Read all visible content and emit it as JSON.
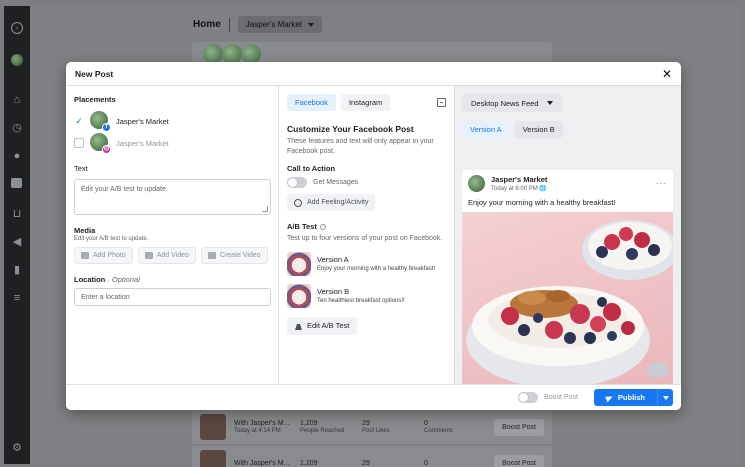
{
  "background": {
    "home_label": "Home",
    "page_selector": "Jasper's Market",
    "rows": [
      {
        "name": "With Jasper's M...",
        "time": "Today at 4:14 PM",
        "reach": "1,209",
        "reach_label": "People Reached",
        "likes": "29",
        "likes_label": "Post Likes",
        "comments": "0",
        "comments_label": "Comments",
        "boost": "Boost Post"
      },
      {
        "name": "With Jasper's M...",
        "reach": "1,209",
        "likes": "29",
        "comments": "0",
        "boost": "Boost Post"
      }
    ]
  },
  "sidebar": {
    "icons": [
      "arrow-right-circle-icon",
      "leaf-avatar-icon",
      "home-icon",
      "history-icon",
      "chat-bubble-icon",
      "pages-icon",
      "shop-icon",
      "megaphone-icon",
      "insights-icon",
      "menu-icon",
      "settings-icon"
    ]
  },
  "modal": {
    "title": "New Post",
    "close_glyph": "✕",
    "placements": {
      "title": "Placements",
      "items": [
        {
          "name": "Jasper's Market",
          "network": "facebook",
          "checked": true
        },
        {
          "name": "Jasper's Market",
          "network": "instagram",
          "checked": false
        }
      ]
    },
    "text": {
      "title": "Text",
      "placeholder": "Edit your A/B test to update."
    },
    "media": {
      "title": "Media",
      "note": "Edit your A/B test to update.",
      "buttons": [
        "Add Photo",
        "Add Video",
        "Create Video"
      ]
    },
    "location": {
      "title": "Location",
      "optional": "Optional",
      "separator": " · ",
      "placeholder": "Enter a location"
    },
    "customize": {
      "tabs": [
        "Facebook",
        "Instagram"
      ],
      "title": "Customize Your Facebook Post",
      "description": "These features and text will only appear in your Facebook post.",
      "cta_title": "Call to Action",
      "cta_toggle": "Get Messages",
      "feeling_button": "Add Feeling/Activity",
      "ab_title": "A/B Test",
      "ab_description": "Test up to four versions of your post on Facebook.",
      "versions": [
        {
          "name": "Version A",
          "text": "Enjoy your morning with a healthy breakfast!"
        },
        {
          "name": "Version B",
          "text": "Ten healthiest breakfast options!!"
        }
      ],
      "edit_button": "Edit A/B Test"
    },
    "preview": {
      "feed_selector": "Desktop News Feed",
      "version_tabs": [
        "Version A",
        "Version B"
      ],
      "page_name": "Jasper's Market",
      "time": "Today at 6:00 PM",
      "globe": "🌐",
      "more": "···",
      "caption": "Enjoy your morning with a healthy breakfast!"
    },
    "footer": {
      "boost_label": "Boost Post",
      "publish_label": "Publish"
    }
  },
  "colors": {
    "accent": "#1877f2",
    "sidebar": "#1f2021",
    "overlay": "#7f8083"
  }
}
